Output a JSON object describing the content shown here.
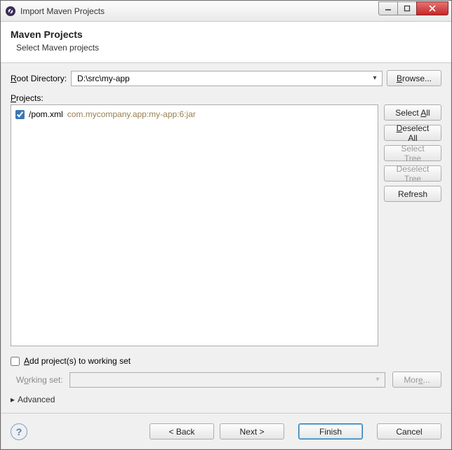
{
  "window": {
    "title": "Import Maven Projects"
  },
  "banner": {
    "heading": "Maven Projects",
    "subtitle": "Select Maven projects"
  },
  "rootDir": {
    "label": "Root Directory:",
    "value": "D:\\src\\my-app",
    "browse": "Browse..."
  },
  "projects": {
    "label": "Projects:",
    "items": [
      {
        "checked": true,
        "path": "/pom.xml",
        "desc": "com.mycompany.app:my-app:6:jar"
      }
    ],
    "buttons": {
      "selectAll": "Select All",
      "deselectAll": "Deselect All",
      "selectTree": "Select Tree",
      "deselectTree": "Deselect Tree",
      "refresh": "Refresh"
    }
  },
  "workingSet": {
    "checkboxLabel": "Add project(s) to working set",
    "label": "Working set:",
    "value": "",
    "more": "More..."
  },
  "advanced": {
    "label": "Advanced"
  },
  "footer": {
    "back": "< Back",
    "next": "Next >",
    "finish": "Finish",
    "cancel": "Cancel"
  }
}
